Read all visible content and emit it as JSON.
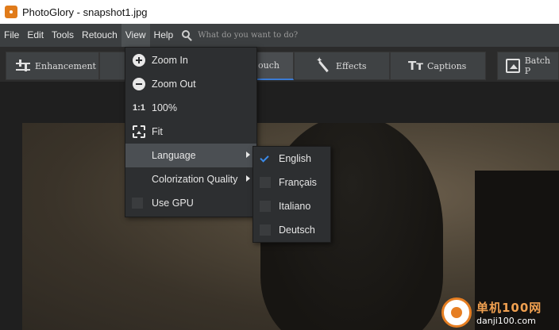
{
  "window": {
    "title": "PhotoGlory - snapshot1.jpg"
  },
  "menubar": {
    "items": [
      "File",
      "Edit",
      "Tools",
      "Retouch",
      "View",
      "Help"
    ],
    "active": "View",
    "search_placeholder": "What do you want to do?"
  },
  "toolbar": {
    "tabs": [
      {
        "label": "Enhancement",
        "icon": "sliders-icon"
      },
      {
        "label": "ouch",
        "icon": ""
      },
      {
        "label": "Effects",
        "icon": "magic-wand-icon"
      },
      {
        "label": "Captions",
        "icon": "text-icon"
      },
      {
        "label": "Batch P",
        "icon": "image-batch-icon"
      }
    ],
    "selected": "Retouch"
  },
  "view_menu": {
    "items": [
      {
        "label": "Zoom In",
        "icon": "zoom-in-icon"
      },
      {
        "label": "Zoom Out",
        "icon": "zoom-out-icon"
      },
      {
        "label": "100%",
        "icon_text": "1:1"
      },
      {
        "label": "Fit",
        "icon": "fit-icon"
      },
      {
        "label": "Language",
        "submenu": true,
        "highlighted": true
      },
      {
        "label": "Colorization Quality",
        "submenu": true
      },
      {
        "label": "Use GPU",
        "checkbox": true,
        "checked": false
      }
    ]
  },
  "language_menu": {
    "items": [
      {
        "label": "English",
        "checked": true
      },
      {
        "label": "Français",
        "checked": false
      },
      {
        "label": "Italiano",
        "checked": false
      },
      {
        "label": "Deutsch",
        "checked": false
      }
    ]
  },
  "watermark": {
    "line1": "单机100网",
    "line2": "danji100.com"
  },
  "colors": {
    "accent": "#3b8bea",
    "menubar": "#3c3f41",
    "menu_bg": "#2d2f31",
    "highlight": "#4b4f53"
  }
}
